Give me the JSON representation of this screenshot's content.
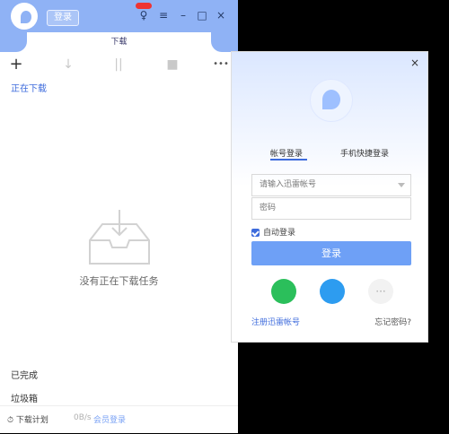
{
  "window": {
    "login_label": "登录",
    "tab_label": "下载",
    "buttons": {
      "skin": "♀",
      "menu": "≡",
      "minimize": "–",
      "maximize": "□",
      "close": "×"
    }
  },
  "toolbar": {
    "add": "+",
    "download": "↓",
    "pause": "||",
    "delete": "■",
    "more": "•••"
  },
  "main": {
    "section_title": "正在下载",
    "empty_text": "没有正在下载任务",
    "sidebar": [
      "已完成",
      "垃圾箱"
    ]
  },
  "footer": {
    "plan": "下载计划",
    "speed": "0B/s",
    "member": "会员登录"
  },
  "login_panel": {
    "close": "×",
    "tabs": [
      "帐号登录",
      "手机快捷登录"
    ],
    "username_placeholder": "请输入迅雷帐号",
    "password_placeholder": "密码",
    "auto_login": "自动登录",
    "login_button": "登录",
    "register": "注册迅雷帐号",
    "forgot": "忘记密码?",
    "more_icon": "···"
  }
}
